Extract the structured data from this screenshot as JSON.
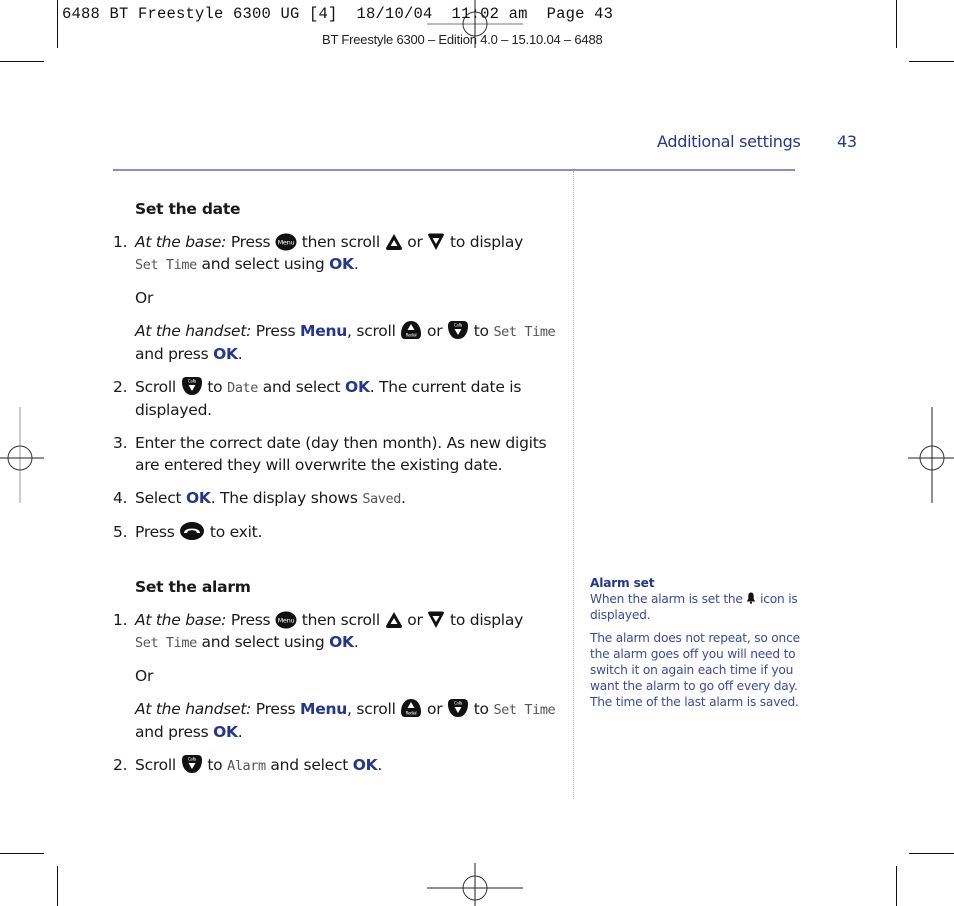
{
  "print_slug": "6488 BT Freestyle 6300 UG [4]  18/10/04  11:02 am  Page 43",
  "edition_line": "BT Freestyle 6300 – Edition 4.0 – 15.10.04 – 6488",
  "header": {
    "section_title": "Additional settings",
    "page_number": "43"
  },
  "colors": {
    "brand_blue": "#24378c",
    "rule_lavender": "#8e8ac8",
    "sidebar_text": "#3b4aa0"
  },
  "icons": {
    "menu_button": "menu-button-icon",
    "scroll_up": "scroll-up-icon",
    "scroll_down": "scroll-down-icon",
    "redial_up": "redial-up-icon",
    "calls_down": "calls-down-icon",
    "end_call": "end-call-icon",
    "alarm_bell": "bell-icon"
  },
  "set_date": {
    "heading": "Set the date",
    "steps": [
      {
        "num": "1.",
        "base_label": "At the base:",
        "base_press": " Press ",
        "base_then": " then scroll ",
        "base_or": " or ",
        "base_to": " to display",
        "display_value": "Set Time",
        "select_using": " and select using ",
        "ok": "OK",
        "period": ".",
        "or_text": "Or",
        "handset_label": "At the handset:",
        "handset_press": " Press ",
        "menu": "Menu",
        "scroll": ", scroll ",
        "or2": " or ",
        "to": " to ",
        "handset_value": "Set Time",
        "and_press": "and press ",
        "ok2": "OK",
        "period2": "."
      },
      {
        "num": "2.",
        "pre": "Scroll ",
        "to": " to ",
        "value": "Date",
        "mid": " and select ",
        "ok": "OK",
        "post": ". The current date is displayed."
      },
      {
        "num": "3.",
        "text": "Enter the correct date (day then month). As new digits are entered they will overwrite the existing date."
      },
      {
        "num": "4.",
        "pre": "Select ",
        "ok": "OK",
        "mid": ". The display shows ",
        "value": "Saved",
        "post": "."
      },
      {
        "num": "5.",
        "pre": "Press ",
        "post": " to exit."
      }
    ]
  },
  "set_alarm": {
    "heading": "Set the alarm",
    "steps": [
      {
        "num": "1.",
        "base_label": "At the base:",
        "base_press": " Press ",
        "base_then": " then scroll ",
        "base_or": " or ",
        "base_to": " to display",
        "display_value": "Set Time",
        "select_using": " and select using ",
        "ok": "OK",
        "period": ".",
        "or_text": "Or",
        "handset_label": "At the handset:",
        "handset_press": " Press ",
        "menu": "Menu",
        "scroll": ", scroll ",
        "or2": " or ",
        "to": " to ",
        "handset_value": "Set Time",
        "and_press": "and press ",
        "ok2": "OK",
        "period2": "."
      },
      {
        "num": "2.",
        "pre": "Scroll ",
        "to": " to ",
        "value": "Alarm",
        "mid": " and select ",
        "ok": "OK",
        "post": "."
      }
    ]
  },
  "sidebar": {
    "title": "Alarm set",
    "p1_pre": "When the alarm is set the ",
    "p1_post": " icon is displayed.",
    "p2": "The alarm does not repeat, so once the alarm goes off you will need to switch it on again each time if you want the alarm to go off every day. The time of the last alarm is saved."
  }
}
